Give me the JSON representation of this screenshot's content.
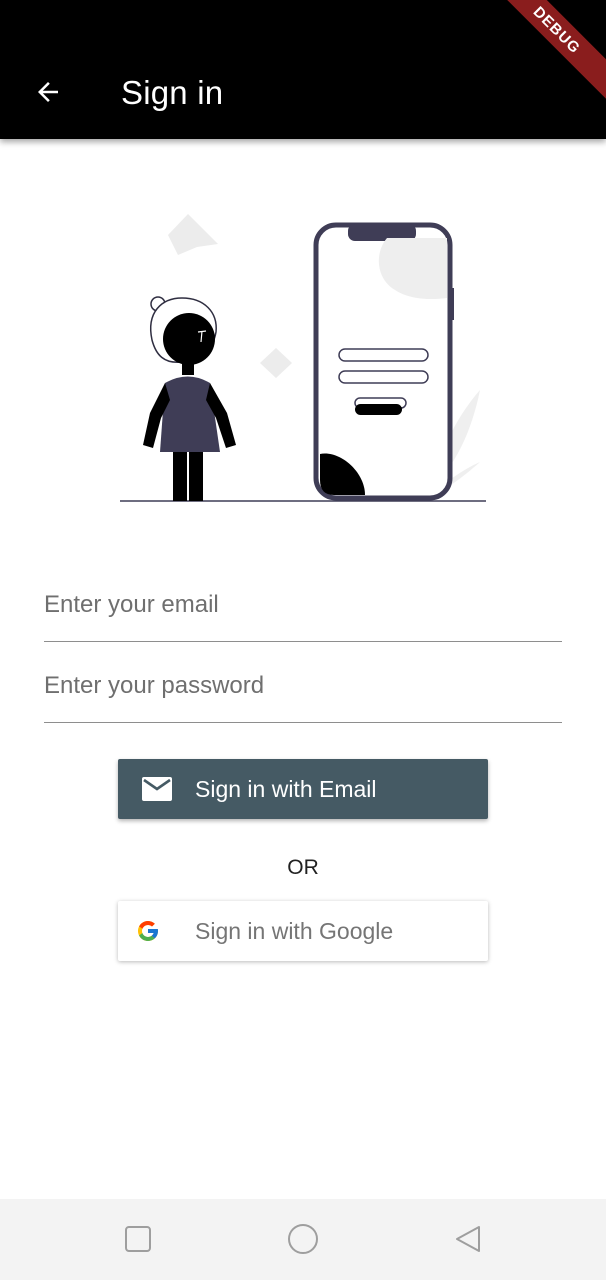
{
  "app_bar": {
    "title": "Sign in",
    "debug_banner": "DEBUG",
    "back_icon": "arrow-back-icon"
  },
  "illustration": {
    "icon": "person-with-phone-login-illustration"
  },
  "form": {
    "email_placeholder": "Enter your email",
    "email_value": "",
    "password_placeholder": "Enter your password",
    "password_value": ""
  },
  "buttons": {
    "email_label": "Sign in with Email",
    "email_icon": "mail-icon",
    "email_color": "#455a64",
    "or_text": "OR",
    "google_label": "Sign in with Google",
    "google_icon": "google-g-icon"
  },
  "nav_bar": {
    "icons": [
      "recent-apps-square-icon",
      "home-circle-icon",
      "back-triangle-icon"
    ]
  }
}
